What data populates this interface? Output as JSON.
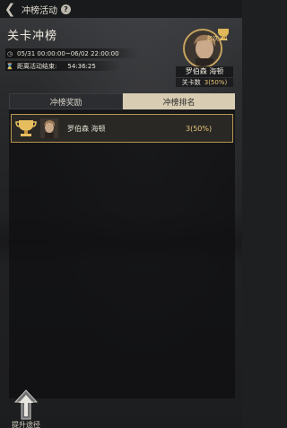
{
  "header": {
    "back_icon": "chevron-left-icon",
    "title": "冲榜活动",
    "help_label": "?"
  },
  "section_title": "关卡冲榜",
  "info": {
    "date_range": "05/31 00:00:00~06/02 22:00:00",
    "countdown_label": "距离活动结束:",
    "countdown_value": "54:36:25"
  },
  "player_card": {
    "rank_label": "名次",
    "rank_value": "1",
    "name": "罗伯森 海顿",
    "stat_label": "关卡数",
    "stat_value": "3(50%)"
  },
  "tabs": [
    {
      "label": "冲榜奖励",
      "active": false
    },
    {
      "label": "冲榜排名",
      "active": true
    }
  ],
  "ranking": [
    {
      "icon": "trophy-icon",
      "name": "罗伯森 海顿",
      "score": "3(50%)"
    }
  ],
  "boost": {
    "label": "提升途径",
    "icon": "up-arrow-icon"
  },
  "colors": {
    "accent": "#c7a45e",
    "tab_active": "#d8ccb2",
    "score": "#e8c57a"
  }
}
